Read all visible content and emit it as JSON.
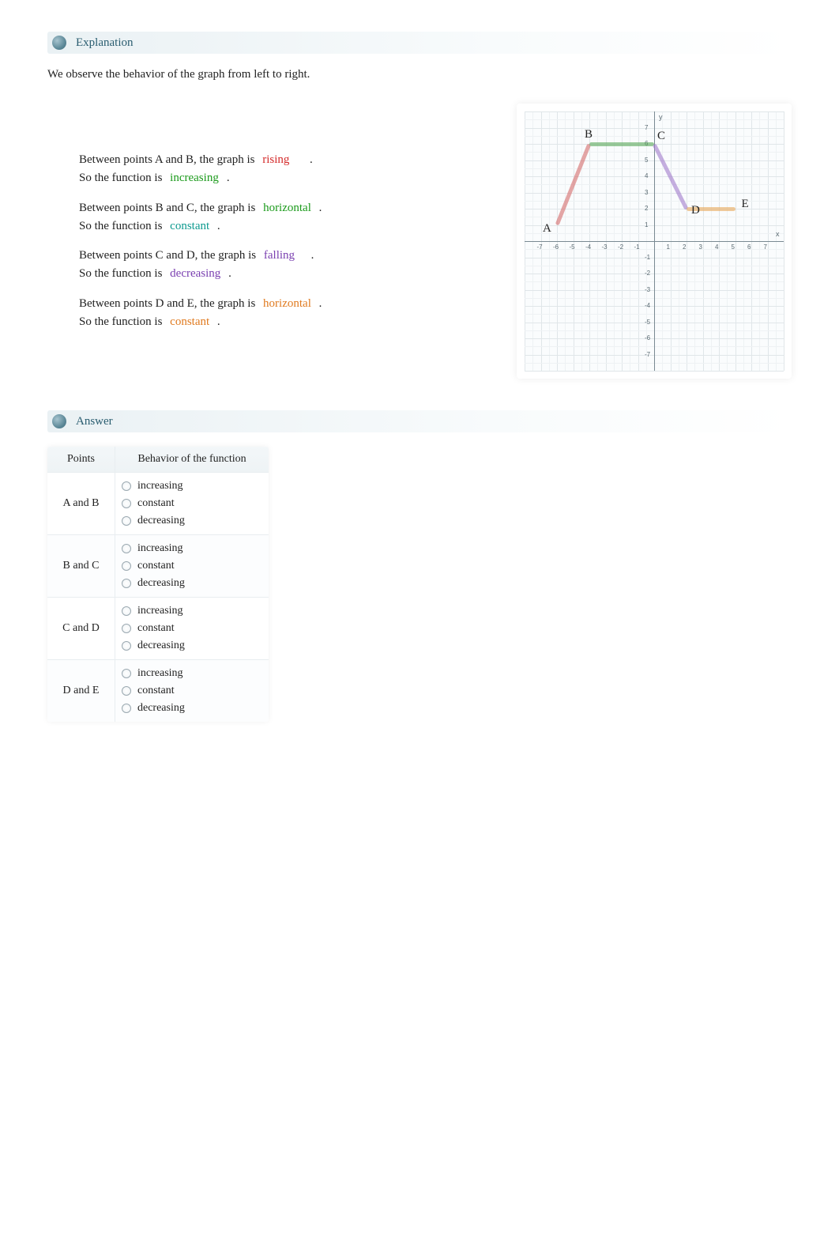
{
  "sections": {
    "explanation_title": "Explanation",
    "answer_title": "Answer"
  },
  "intro": "We observe the behavior of the graph from left to right.",
  "lines": {
    "ab1_pre": "Between points A and B, the graph is ",
    "ab1_blank": "rising",
    "ab2_pre": "So the function is ",
    "ab2_blank": "increasing",
    "bc1_pre": "Between points B and C, the graph is ",
    "bc1_blank": "horizontal",
    "bc2_pre": "So the function is ",
    "bc2_blank": "constant",
    "cd1_pre": "Between points C and D, the graph is ",
    "cd1_blank": "falling",
    "cd2_pre": "So the function is ",
    "cd2_blank": "decreasing",
    "de1_pre": "Between points D and E, the graph is ",
    "de1_blank": "horizontal",
    "de2_pre": "So the function is ",
    "de2_blank": "constant",
    "period": "."
  },
  "table": {
    "head_points": "Points",
    "head_behavior": "Behavior of the function",
    "rows": [
      {
        "label": "A and B"
      },
      {
        "label": "B and C"
      },
      {
        "label": "C and D"
      },
      {
        "label": "D and E"
      }
    ],
    "options": [
      "increasing",
      "constant",
      "decreasing"
    ]
  },
  "chart_data": {
    "type": "line",
    "title": "",
    "xlabel": "x",
    "ylabel": "y",
    "xlim": [
      -8,
      8
    ],
    "ylim": [
      -8,
      8
    ],
    "x_ticks": [
      -7,
      -6,
      -5,
      -4,
      -3,
      -2,
      -1,
      1,
      2,
      3,
      4,
      5,
      6,
      7
    ],
    "y_ticks": [
      -7,
      -6,
      -5,
      -4,
      -3,
      -2,
      -1,
      1,
      2,
      3,
      4,
      5,
      6,
      7
    ],
    "points": {
      "A": [
        -6,
        1
      ],
      "B": [
        -4,
        6
      ],
      "C": [
        0,
        6
      ],
      "D": [
        2,
        2
      ],
      "E": [
        5,
        2
      ]
    },
    "segments": [
      {
        "from": "A",
        "to": "B",
        "color": "#d46a6a"
      },
      {
        "from": "B",
        "to": "C",
        "color": "#5aa85a"
      },
      {
        "from": "C",
        "to": "D",
        "color": "#a07acc"
      },
      {
        "from": "D",
        "to": "E",
        "color": "#e8a95a"
      }
    ]
  }
}
